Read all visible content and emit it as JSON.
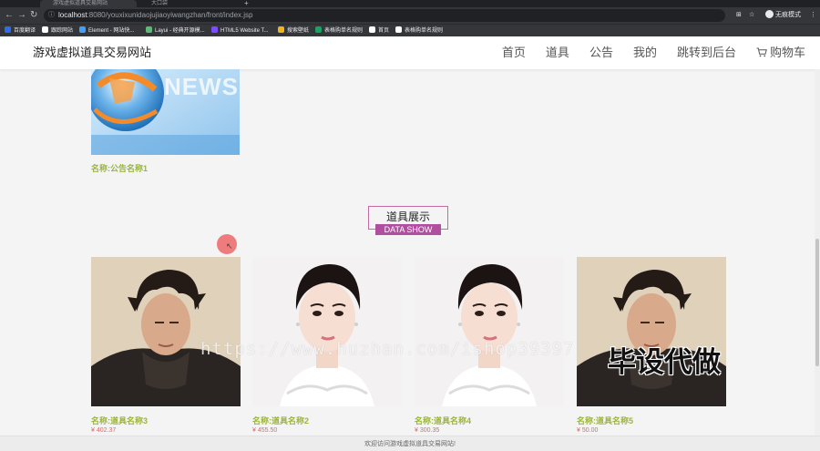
{
  "browser": {
    "tabs": [
      {
        "label": "游戏虚拟道具交易网站"
      },
      {
        "label": "大口袋"
      }
    ],
    "url_host": "localhost",
    "url_path": ":8080/youxixunidaojujiaoyiwangzhan/front/index.jsp",
    "profile_label": "无痕模式",
    "bookmarks": [
      {
        "label": "百度翻译",
        "color": "#2e6bf0"
      },
      {
        "label": "跟踪网站",
        "color": "#ffffff"
      },
      {
        "label": "Element - 网站快...",
        "color": "#409eff"
      },
      {
        "label": "Layui - 经典开源模...",
        "color": "#5fb878"
      },
      {
        "label": "HTML5 Website T...",
        "color": "#7c4dff"
      },
      {
        "label": "搜索壁纸",
        "color": "#f0b41d"
      },
      {
        "label": "表格购单名规则",
        "color": "#1aa260"
      },
      {
        "label": "首页",
        "color": "#ffffff"
      },
      {
        "label": "表格购单名规则",
        "color": "#ffffff"
      }
    ]
  },
  "header": {
    "logo": "游戏虚拟道具交易网站",
    "nav": [
      {
        "label": "首页"
      },
      {
        "label": "道具"
      },
      {
        "label": "公告"
      },
      {
        "label": "我的"
      },
      {
        "label": "跳转到后台"
      },
      {
        "label": "购物车"
      }
    ]
  },
  "notice": {
    "image_text": "NEWS",
    "name": "名称:公告名称1"
  },
  "section": {
    "title": "道具展示",
    "subtitle": "DATA SHOW"
  },
  "products": [
    {
      "name": "名称:道具名称3",
      "price": "¥ 402.37",
      "image": "man"
    },
    {
      "name": "名称:道具名称2",
      "price": "¥ 455.50",
      "image": "woman"
    },
    {
      "name": "名称:道具名称4",
      "price": "¥ 300.35",
      "image": "woman"
    },
    {
      "name": "名称:道具名称5",
      "price": "¥ 50.00",
      "image": "man"
    }
  ],
  "watermark": {
    "url": "https://www.huzhan.com/ishop39397",
    "text": "毕设代做"
  },
  "footer": {
    "text": "欢迎访问游戏虚拟道具交易网站!"
  }
}
